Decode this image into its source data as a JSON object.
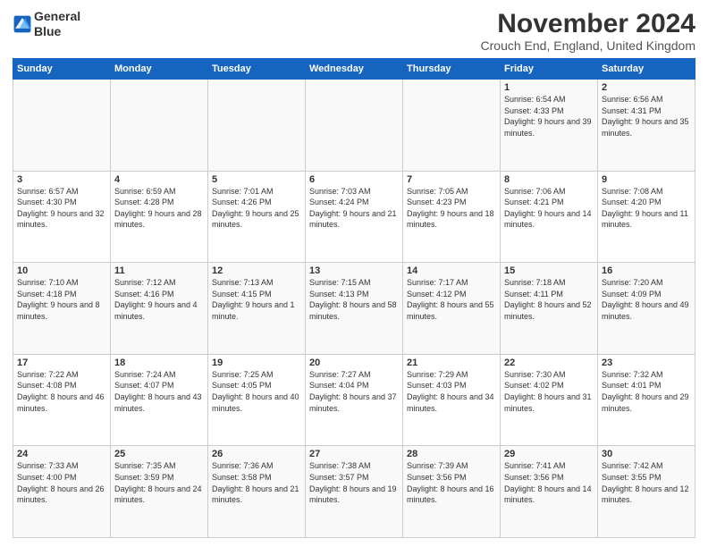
{
  "logo": {
    "line1": "General",
    "line2": "Blue"
  },
  "title": "November 2024",
  "subtitle": "Crouch End, England, United Kingdom",
  "days_of_week": [
    "Sunday",
    "Monday",
    "Tuesday",
    "Wednesday",
    "Thursday",
    "Friday",
    "Saturday"
  ],
  "weeks": [
    [
      {
        "day": "",
        "info": ""
      },
      {
        "day": "",
        "info": ""
      },
      {
        "day": "",
        "info": ""
      },
      {
        "day": "",
        "info": ""
      },
      {
        "day": "",
        "info": ""
      },
      {
        "day": "1",
        "info": "Sunrise: 6:54 AM\nSunset: 4:33 PM\nDaylight: 9 hours\nand 39 minutes."
      },
      {
        "day": "2",
        "info": "Sunrise: 6:56 AM\nSunset: 4:31 PM\nDaylight: 9 hours\nand 35 minutes."
      }
    ],
    [
      {
        "day": "3",
        "info": "Sunrise: 6:57 AM\nSunset: 4:30 PM\nDaylight: 9 hours\nand 32 minutes."
      },
      {
        "day": "4",
        "info": "Sunrise: 6:59 AM\nSunset: 4:28 PM\nDaylight: 9 hours\nand 28 minutes."
      },
      {
        "day": "5",
        "info": "Sunrise: 7:01 AM\nSunset: 4:26 PM\nDaylight: 9 hours\nand 25 minutes."
      },
      {
        "day": "6",
        "info": "Sunrise: 7:03 AM\nSunset: 4:24 PM\nDaylight: 9 hours\nand 21 minutes."
      },
      {
        "day": "7",
        "info": "Sunrise: 7:05 AM\nSunset: 4:23 PM\nDaylight: 9 hours\nand 18 minutes."
      },
      {
        "day": "8",
        "info": "Sunrise: 7:06 AM\nSunset: 4:21 PM\nDaylight: 9 hours\nand 14 minutes."
      },
      {
        "day": "9",
        "info": "Sunrise: 7:08 AM\nSunset: 4:20 PM\nDaylight: 9 hours\nand 11 minutes."
      }
    ],
    [
      {
        "day": "10",
        "info": "Sunrise: 7:10 AM\nSunset: 4:18 PM\nDaylight: 9 hours\nand 8 minutes."
      },
      {
        "day": "11",
        "info": "Sunrise: 7:12 AM\nSunset: 4:16 PM\nDaylight: 9 hours\nand 4 minutes."
      },
      {
        "day": "12",
        "info": "Sunrise: 7:13 AM\nSunset: 4:15 PM\nDaylight: 9 hours\nand 1 minute."
      },
      {
        "day": "13",
        "info": "Sunrise: 7:15 AM\nSunset: 4:13 PM\nDaylight: 8 hours\nand 58 minutes."
      },
      {
        "day": "14",
        "info": "Sunrise: 7:17 AM\nSunset: 4:12 PM\nDaylight: 8 hours\nand 55 minutes."
      },
      {
        "day": "15",
        "info": "Sunrise: 7:18 AM\nSunset: 4:11 PM\nDaylight: 8 hours\nand 52 minutes."
      },
      {
        "day": "16",
        "info": "Sunrise: 7:20 AM\nSunset: 4:09 PM\nDaylight: 8 hours\nand 49 minutes."
      }
    ],
    [
      {
        "day": "17",
        "info": "Sunrise: 7:22 AM\nSunset: 4:08 PM\nDaylight: 8 hours\nand 46 minutes."
      },
      {
        "day": "18",
        "info": "Sunrise: 7:24 AM\nSunset: 4:07 PM\nDaylight: 8 hours\nand 43 minutes."
      },
      {
        "day": "19",
        "info": "Sunrise: 7:25 AM\nSunset: 4:05 PM\nDaylight: 8 hours\nand 40 minutes."
      },
      {
        "day": "20",
        "info": "Sunrise: 7:27 AM\nSunset: 4:04 PM\nDaylight: 8 hours\nand 37 minutes."
      },
      {
        "day": "21",
        "info": "Sunrise: 7:29 AM\nSunset: 4:03 PM\nDaylight: 8 hours\nand 34 minutes."
      },
      {
        "day": "22",
        "info": "Sunrise: 7:30 AM\nSunset: 4:02 PM\nDaylight: 8 hours\nand 31 minutes."
      },
      {
        "day": "23",
        "info": "Sunrise: 7:32 AM\nSunset: 4:01 PM\nDaylight: 8 hours\nand 29 minutes."
      }
    ],
    [
      {
        "day": "24",
        "info": "Sunrise: 7:33 AM\nSunset: 4:00 PM\nDaylight: 8 hours\nand 26 minutes."
      },
      {
        "day": "25",
        "info": "Sunrise: 7:35 AM\nSunset: 3:59 PM\nDaylight: 8 hours\nand 24 minutes."
      },
      {
        "day": "26",
        "info": "Sunrise: 7:36 AM\nSunset: 3:58 PM\nDaylight: 8 hours\nand 21 minutes."
      },
      {
        "day": "27",
        "info": "Sunrise: 7:38 AM\nSunset: 3:57 PM\nDaylight: 8 hours\nand 19 minutes."
      },
      {
        "day": "28",
        "info": "Sunrise: 7:39 AM\nSunset: 3:56 PM\nDaylight: 8 hours\nand 16 minutes."
      },
      {
        "day": "29",
        "info": "Sunrise: 7:41 AM\nSunset: 3:56 PM\nDaylight: 8 hours\nand 14 minutes."
      },
      {
        "day": "30",
        "info": "Sunrise: 7:42 AM\nSunset: 3:55 PM\nDaylight: 8 hours\nand 12 minutes."
      }
    ]
  ]
}
